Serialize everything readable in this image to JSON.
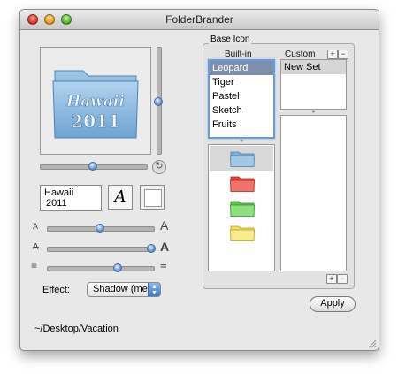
{
  "window": {
    "title": "FolderBrander"
  },
  "preview": {
    "line1": "Hawaii",
    "line2": "2011"
  },
  "rotate_icon": "rotate-icon",
  "text_field": {
    "line1": "Hawaii",
    "line2": "2011"
  },
  "font_button": {
    "glyph": "A"
  },
  "size_slider": {
    "min_glyph": "A",
    "max_glyph": "A",
    "value": 0.5
  },
  "outline_slider": {
    "min_glyph": "A",
    "max_glyph": "A",
    "value": 0.95
  },
  "spacing_slider": {
    "value": 0.65
  },
  "effect": {
    "label": "Effect:",
    "selected": "Shadow (mediu"
  },
  "path": "~/Desktop/Vacation",
  "base_icon": {
    "title": "Base Icon",
    "builtin_header": "Built-in",
    "custom_header": "Custom",
    "builtin_sets": [
      "Leopard",
      "Tiger",
      "Pastel",
      "Sketch",
      "Fruits"
    ],
    "selected_builtin": "Leopard",
    "custom_sets": [
      "New Set"
    ],
    "folder_colors": [
      "#7fb0da",
      "#e34a44",
      "#5ec64e",
      "#f2de5a"
    ]
  },
  "apply_label": "Apply"
}
